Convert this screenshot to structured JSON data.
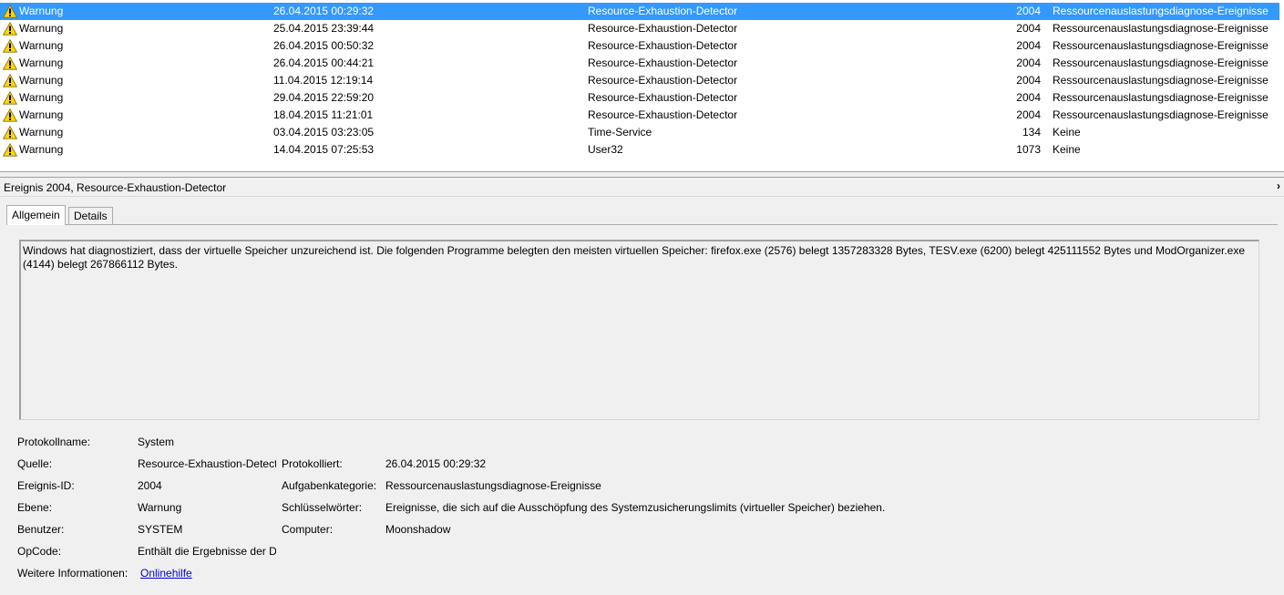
{
  "events": [
    {
      "level": "Warnung",
      "date": "26.04.2015 00:29:32",
      "source": "Resource-Exhaustion-Detector",
      "id": "2004",
      "category": "Ressourcenauslastungsdiagnose-Ereignisse",
      "selected": true
    },
    {
      "level": "Warnung",
      "date": "25.04.2015 23:39:44",
      "source": "Resource-Exhaustion-Detector",
      "id": "2004",
      "category": "Ressourcenauslastungsdiagnose-Ereignisse"
    },
    {
      "level": "Warnung",
      "date": "26.04.2015 00:50:32",
      "source": "Resource-Exhaustion-Detector",
      "id": "2004",
      "category": "Ressourcenauslastungsdiagnose-Ereignisse"
    },
    {
      "level": "Warnung",
      "date": "26.04.2015 00:44:21",
      "source": "Resource-Exhaustion-Detector",
      "id": "2004",
      "category": "Ressourcenauslastungsdiagnose-Ereignisse"
    },
    {
      "level": "Warnung",
      "date": "11.04.2015 12:19:14",
      "source": "Resource-Exhaustion-Detector",
      "id": "2004",
      "category": "Ressourcenauslastungsdiagnose-Ereignisse"
    },
    {
      "level": "Warnung",
      "date": "29.04.2015 22:59:20",
      "source": "Resource-Exhaustion-Detector",
      "id": "2004",
      "category": "Ressourcenauslastungsdiagnose-Ereignisse"
    },
    {
      "level": "Warnung",
      "date": "18.04.2015 11:21:01",
      "source": "Resource-Exhaustion-Detector",
      "id": "2004",
      "category": "Ressourcenauslastungsdiagnose-Ereignisse"
    },
    {
      "level": "Warnung",
      "date": "03.04.2015 03:23:05",
      "source": "Time-Service",
      "id": "134",
      "category": "Keine"
    },
    {
      "level": "Warnung",
      "date": "14.04.2015 07:25:53",
      "source": "User32",
      "id": "1073",
      "category": "Keine"
    }
  ],
  "icons": {
    "warning": "warning-triangle-icon",
    "collapse": "chevron-right-icon"
  },
  "colors": {
    "selection": "#3399ff",
    "warning_fill": "#ffd800",
    "link": "#0000cc"
  },
  "detail": {
    "title": "Ereignis 2004, Resource-Exhaustion-Detector",
    "collapse_glyph": "›",
    "tabs": {
      "general": "Allgemein",
      "details": "Details"
    },
    "message": "Windows hat diagnostiziert, dass der virtuelle Speicher unzureichend ist. Die folgenden Programme belegten den meisten virtuellen Speicher: firefox.exe (2576) belegt 1357283328 Bytes, TESV.exe (6200) belegt 425111552 Bytes und ModOrganizer.exe (4144) belegt 267866112 Bytes.",
    "props": {
      "log_name_label": "Protokollname:",
      "log_name": "System",
      "source_label": "Quelle:",
      "source": "Resource-Exhaustion-Detect",
      "logged_label": "Protokolliert:",
      "logged": "26.04.2015 00:29:32",
      "event_id_label": "Ereignis-ID:",
      "event_id": "2004",
      "task_label": "Aufgabenkategorie:",
      "task": "Ressourcenauslastungsdiagnose-Ereignisse",
      "level_label": "Ebene:",
      "level": "Warnung",
      "keywords_label": "Schlüsselwörter:",
      "keywords": "Ereignisse, die sich auf die Ausschöpfung des Systemzusicherungslimits (virtueller Speicher) beziehen.",
      "user_label": "Benutzer:",
      "user": "SYSTEM",
      "computer_label": "Computer:",
      "computer": "Moonshadow",
      "opcode_label": "OpCode:",
      "opcode": "Enthält die Ergebnisse der Di",
      "more_info_label": "Weitere Informationen:",
      "more_info_link": "Onlinehilfe"
    }
  }
}
